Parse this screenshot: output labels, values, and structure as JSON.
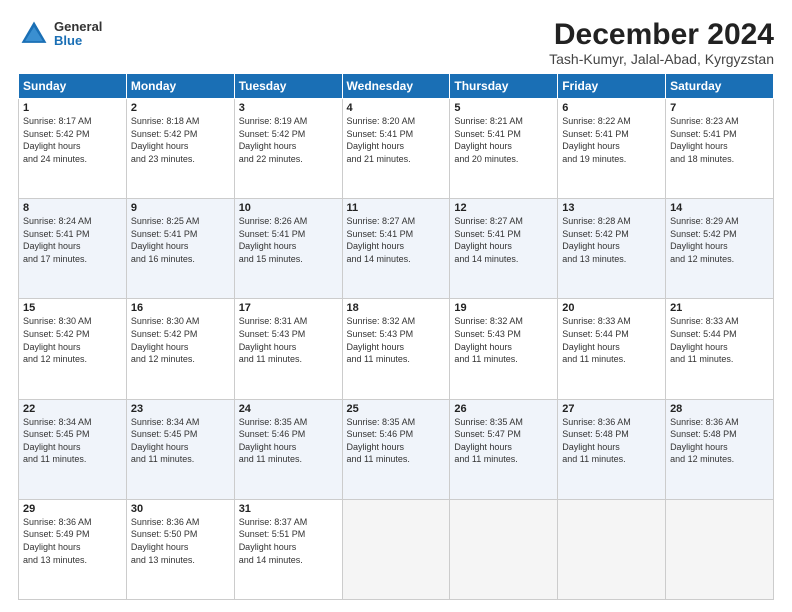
{
  "logo": {
    "general": "General",
    "blue": "Blue"
  },
  "title": "December 2024",
  "subtitle": "Tash-Kumyr, Jalal-Abad, Kyrgyzstan",
  "days_header": [
    "Sunday",
    "Monday",
    "Tuesday",
    "Wednesday",
    "Thursday",
    "Friday",
    "Saturday"
  ],
  "weeks": [
    [
      {
        "day": "1",
        "sunrise": "8:17 AM",
        "sunset": "5:42 PM",
        "daylight": "9 hours and 24 minutes."
      },
      {
        "day": "2",
        "sunrise": "8:18 AM",
        "sunset": "5:42 PM",
        "daylight": "9 hours and 23 minutes."
      },
      {
        "day": "3",
        "sunrise": "8:19 AM",
        "sunset": "5:42 PM",
        "daylight": "9 hours and 22 minutes."
      },
      {
        "day": "4",
        "sunrise": "8:20 AM",
        "sunset": "5:41 PM",
        "daylight": "9 hours and 21 minutes."
      },
      {
        "day": "5",
        "sunrise": "8:21 AM",
        "sunset": "5:41 PM",
        "daylight": "9 hours and 20 minutes."
      },
      {
        "day": "6",
        "sunrise": "8:22 AM",
        "sunset": "5:41 PM",
        "daylight": "9 hours and 19 minutes."
      },
      {
        "day": "7",
        "sunrise": "8:23 AM",
        "sunset": "5:41 PM",
        "daylight": "9 hours and 18 minutes."
      }
    ],
    [
      {
        "day": "8",
        "sunrise": "8:24 AM",
        "sunset": "5:41 PM",
        "daylight": "9 hours and 17 minutes."
      },
      {
        "day": "9",
        "sunrise": "8:25 AM",
        "sunset": "5:41 PM",
        "daylight": "9 hours and 16 minutes."
      },
      {
        "day": "10",
        "sunrise": "8:26 AM",
        "sunset": "5:41 PM",
        "daylight": "9 hours and 15 minutes."
      },
      {
        "day": "11",
        "sunrise": "8:27 AM",
        "sunset": "5:41 PM",
        "daylight": "9 hours and 14 minutes."
      },
      {
        "day": "12",
        "sunrise": "8:27 AM",
        "sunset": "5:41 PM",
        "daylight": "9 hours and 14 minutes."
      },
      {
        "day": "13",
        "sunrise": "8:28 AM",
        "sunset": "5:42 PM",
        "daylight": "9 hours and 13 minutes."
      },
      {
        "day": "14",
        "sunrise": "8:29 AM",
        "sunset": "5:42 PM",
        "daylight": "9 hours and 12 minutes."
      }
    ],
    [
      {
        "day": "15",
        "sunrise": "8:30 AM",
        "sunset": "5:42 PM",
        "daylight": "9 hours and 12 minutes."
      },
      {
        "day": "16",
        "sunrise": "8:30 AM",
        "sunset": "5:42 PM",
        "daylight": "9 hours and 12 minutes."
      },
      {
        "day": "17",
        "sunrise": "8:31 AM",
        "sunset": "5:43 PM",
        "daylight": "9 hours and 11 minutes."
      },
      {
        "day": "18",
        "sunrise": "8:32 AM",
        "sunset": "5:43 PM",
        "daylight": "9 hours and 11 minutes."
      },
      {
        "day": "19",
        "sunrise": "8:32 AM",
        "sunset": "5:43 PM",
        "daylight": "9 hours and 11 minutes."
      },
      {
        "day": "20",
        "sunrise": "8:33 AM",
        "sunset": "5:44 PM",
        "daylight": "9 hours and 11 minutes."
      },
      {
        "day": "21",
        "sunrise": "8:33 AM",
        "sunset": "5:44 PM",
        "daylight": "9 hours and 11 minutes."
      }
    ],
    [
      {
        "day": "22",
        "sunrise": "8:34 AM",
        "sunset": "5:45 PM",
        "daylight": "9 hours and 11 minutes."
      },
      {
        "day": "23",
        "sunrise": "8:34 AM",
        "sunset": "5:45 PM",
        "daylight": "9 hours and 11 minutes."
      },
      {
        "day": "24",
        "sunrise": "8:35 AM",
        "sunset": "5:46 PM",
        "daylight": "9 hours and 11 minutes."
      },
      {
        "day": "25",
        "sunrise": "8:35 AM",
        "sunset": "5:46 PM",
        "daylight": "9 hours and 11 minutes."
      },
      {
        "day": "26",
        "sunrise": "8:35 AM",
        "sunset": "5:47 PM",
        "daylight": "9 hours and 11 minutes."
      },
      {
        "day": "27",
        "sunrise": "8:36 AM",
        "sunset": "5:48 PM",
        "daylight": "9 hours and 11 minutes."
      },
      {
        "day": "28",
        "sunrise": "8:36 AM",
        "sunset": "5:48 PM",
        "daylight": "9 hours and 12 minutes."
      }
    ],
    [
      {
        "day": "29",
        "sunrise": "8:36 AM",
        "sunset": "5:49 PM",
        "daylight": "9 hours and 13 minutes."
      },
      {
        "day": "30",
        "sunrise": "8:36 AM",
        "sunset": "5:50 PM",
        "daylight": "9 hours and 13 minutes."
      },
      {
        "day": "31",
        "sunrise": "8:37 AM",
        "sunset": "5:51 PM",
        "daylight": "9 hours and 14 minutes."
      },
      null,
      null,
      null,
      null
    ]
  ]
}
